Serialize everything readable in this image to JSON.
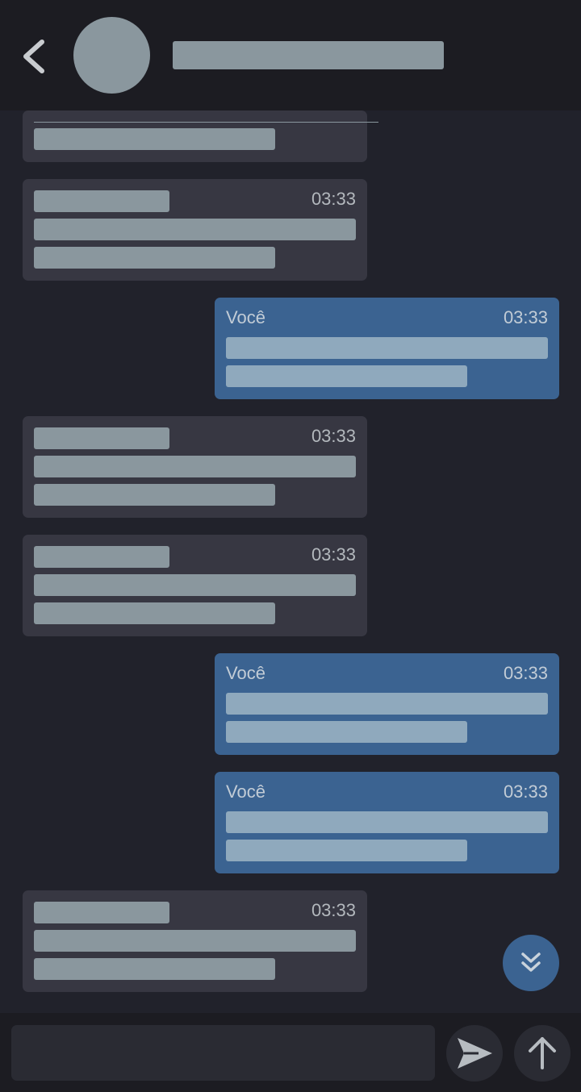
{
  "colors": {
    "background": "#21222b",
    "header": "#1c1c22",
    "incoming_bubble": "#373742",
    "outgoing_bubble": "#3b6391",
    "placeholder": "#8a979e"
  },
  "header": {
    "back_icon": "chevron-left-icon",
    "avatar": "avatar-placeholder"
  },
  "messages": [
    {
      "direction": "in",
      "time": ""
    },
    {
      "direction": "in",
      "time": "03:33"
    },
    {
      "direction": "out",
      "sender": "Você",
      "time": "03:33"
    },
    {
      "direction": "in",
      "time": "03:33"
    },
    {
      "direction": "in",
      "time": "03:33"
    },
    {
      "direction": "out",
      "sender": "Você",
      "time": "03:33"
    },
    {
      "direction": "out",
      "sender": "Você",
      "time": "03:33"
    },
    {
      "direction": "in",
      "time": "03:33"
    }
  ],
  "composer": {
    "input_value": "",
    "send_icon": "send-icon",
    "upload_icon": "arrow-up-icon"
  },
  "scroll_button_icon": "double-chevron-down-icon"
}
